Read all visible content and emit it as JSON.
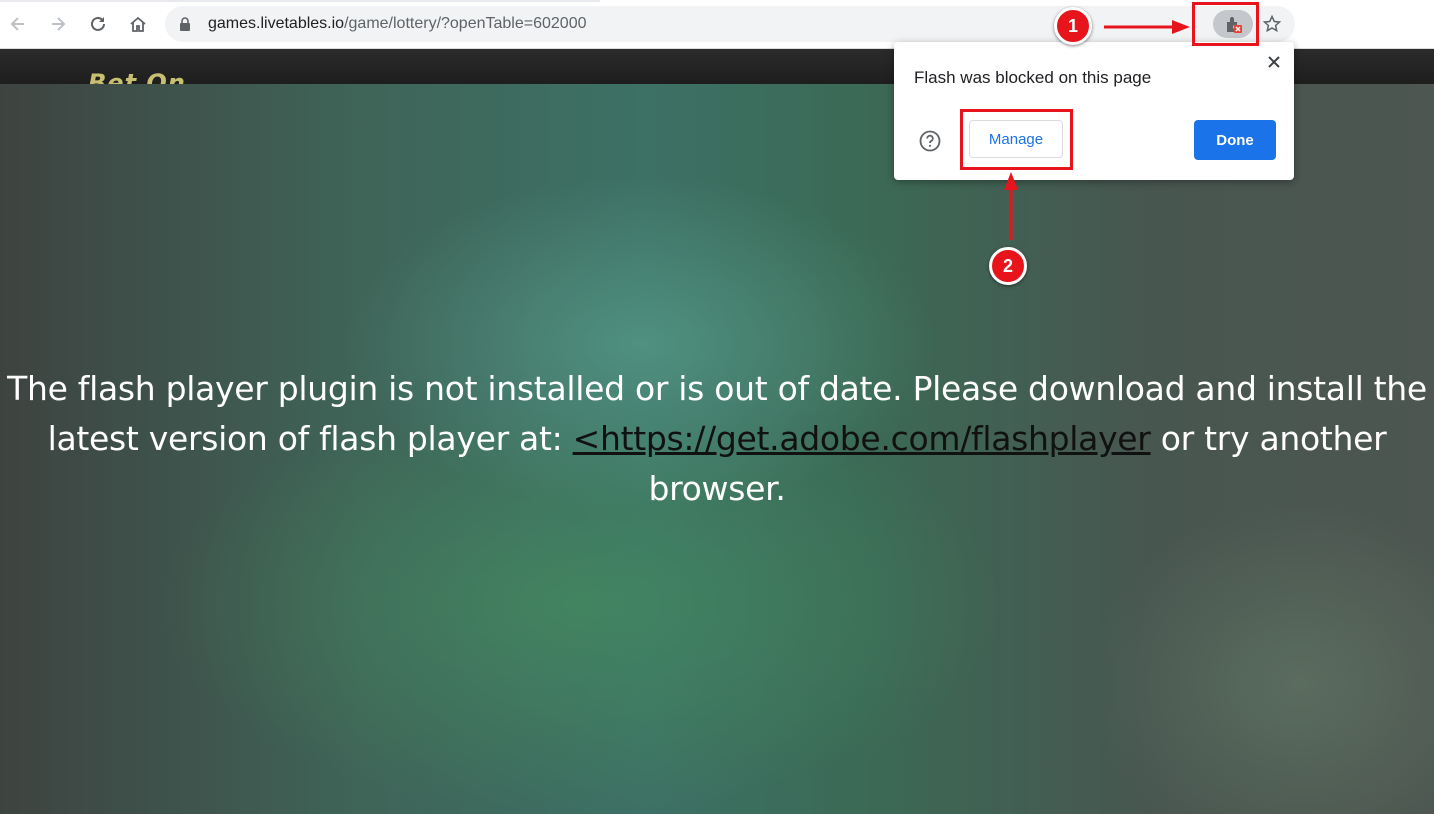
{
  "browser": {
    "url_host": "games.livetables.io",
    "url_path": "/game/lottery/?openTable=602000"
  },
  "page": {
    "message_text": "The flash player plugin is not installed or is out of date. Please download and install the latest version of flash player at: ",
    "message_link": "<https://get.adobe.com/flashplayer",
    "message_tail": " or try another browser."
  },
  "popup": {
    "title": "Flash was blocked on this page",
    "manage_label": "Manage",
    "done_label": "Done"
  },
  "annotations": {
    "step1": "1",
    "step2": "2",
    "color": "#e8141c"
  },
  "colors": {
    "accent": "#1a73e8",
    "omnibox": "#f1f3f4"
  },
  "icons": [
    "back-arrow-icon",
    "forward-arrow-icon",
    "reload-icon",
    "home-icon",
    "lock-icon",
    "plugin-blocked-icon",
    "star-icon",
    "close-icon",
    "help-icon"
  ]
}
